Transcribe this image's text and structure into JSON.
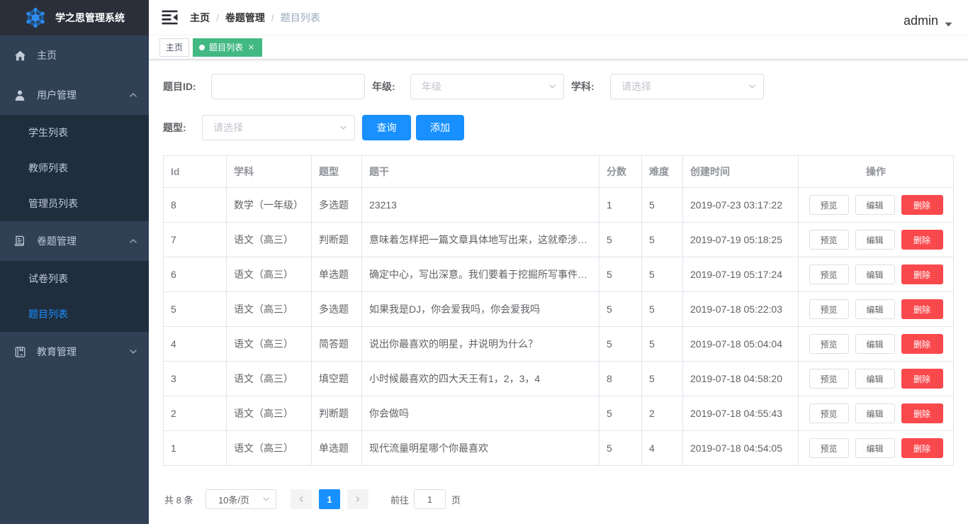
{
  "colors": {
    "accent": "#1890ff",
    "tag_active": "#42b983",
    "danger": "#f9494d",
    "sidebar_bg": "#304156",
    "submenu_bg": "#1f2d3d",
    "logo_bg": "#2b2f3a",
    "menu_text": "#bfcbd9"
  },
  "app": {
    "title": "学之思管理系统"
  },
  "sidebar": {
    "items": [
      {
        "label": "主页"
      },
      {
        "label": "用户管理",
        "children": [
          "学生列表",
          "教师列表",
          "管理员列表"
        ]
      },
      {
        "label": "卷题管理",
        "children": [
          "试卷列表",
          "题目列表"
        ]
      },
      {
        "label": "教育管理"
      }
    ],
    "active_item": "题目列表"
  },
  "navbar": {
    "breadcrumb": [
      "主页",
      "卷题管理",
      "题目列表"
    ],
    "separator": "/",
    "username": "admin"
  },
  "tags": [
    {
      "label": "主页",
      "active": false
    },
    {
      "label": "题目列表",
      "active": true,
      "closable": true
    }
  ],
  "filters": {
    "id_label": "题目ID:",
    "id_value": "",
    "grade_label": "年级:",
    "grade_placeholder": "年级",
    "subject_label": "学科:",
    "subject_placeholder": "请选择",
    "type_label": "题型:",
    "type_placeholder": "请选择",
    "search_label": "查询",
    "add_label": "添加"
  },
  "table": {
    "columns": [
      "Id",
      "学科",
      "题型",
      "题干",
      "分数",
      "难度",
      "创建时间",
      "操作"
    ],
    "action_labels": [
      "预览",
      "编辑",
      "删除"
    ],
    "rows": [
      {
        "id": "8",
        "subject": "数学（一年级）",
        "qtype": "多选题",
        "stem": "23213",
        "score": "1",
        "difficulty": "5",
        "created": "2019-07-23 03:17:22"
      },
      {
        "id": "7",
        "subject": "语文（高三）",
        "qtype": "判断题",
        "stem": "意味着怎样把一篇文章具体地写出来，这就牵涉…",
        "score": "5",
        "difficulty": "5",
        "created": "2019-07-19 05:18:25"
      },
      {
        "id": "6",
        "subject": "语文（高三）",
        "qtype": "单选题",
        "stem": "确定中心，写出深意。我们要着于挖掘所写事件…",
        "score": "5",
        "difficulty": "5",
        "created": "2019-07-19 05:17:24"
      },
      {
        "id": "5",
        "subject": "语文（高三）",
        "qtype": "多选题",
        "stem": "如果我是DJ，你会爱我吗，你会爱我吗",
        "score": "5",
        "difficulty": "5",
        "created": "2019-07-18 05:22:03"
      },
      {
        "id": "4",
        "subject": "语文（高三）",
        "qtype": "简答题",
        "stem": "说出你最喜欢的明星，并说明为什么？",
        "score": "5",
        "difficulty": "5",
        "created": "2019-07-18 05:04:04"
      },
      {
        "id": "3",
        "subject": "语文（高三）",
        "qtype": "填空题",
        "stem": "小时候最喜欢的四大天王有1，2，3，4",
        "score": "8",
        "difficulty": "5",
        "created": "2019-07-18 04:58:20"
      },
      {
        "id": "2",
        "subject": "语文（高三）",
        "qtype": "判断题",
        "stem": "你会做吗",
        "score": "5",
        "difficulty": "2",
        "created": "2019-07-18 04:55:43"
      },
      {
        "id": "1",
        "subject": "语文（高三）",
        "qtype": "单选题",
        "stem": "现代流量明星哪个你最喜欢",
        "score": "5",
        "difficulty": "4",
        "created": "2019-07-18 04:54:05"
      }
    ]
  },
  "pagination": {
    "total_label": "共 8 条",
    "page_size": "10条/页",
    "current_page": "1",
    "jump_prefix": "前往",
    "jump_value": "1",
    "jump_suffix": "页"
  }
}
